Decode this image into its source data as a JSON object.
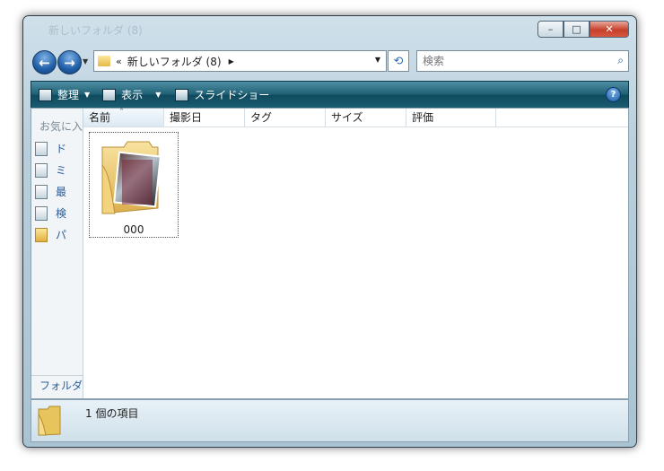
{
  "window": {
    "title": "新しいフォルダ (8)",
    "controls": {
      "minimize": "–",
      "maximize": "□",
      "close": "✕"
    }
  },
  "nav": {
    "back_icon": "back-arrow-icon",
    "forward_icon": "forward-arrow-icon",
    "address_sep": "«",
    "address": "新しいフォルダ (8)",
    "search_placeholder": "検索"
  },
  "toolbar": {
    "organize": "整理",
    "view": "表示",
    "slideshow": "スライドショー"
  },
  "left_pane": {
    "title": "お気に入",
    "items": [
      "ド",
      "ミ",
      "最",
      "検",
      "パ"
    ],
    "folders_link": "フォルダ"
  },
  "columns": [
    "名前",
    "撮影日",
    "タグ",
    "サイズ",
    "評価"
  ],
  "files": [
    {
      "name": "000"
    }
  ],
  "status": "1 個の項目",
  "colors": {
    "accent": "#1f5f74",
    "link": "#2c5d9a",
    "close": "#c6402b"
  }
}
